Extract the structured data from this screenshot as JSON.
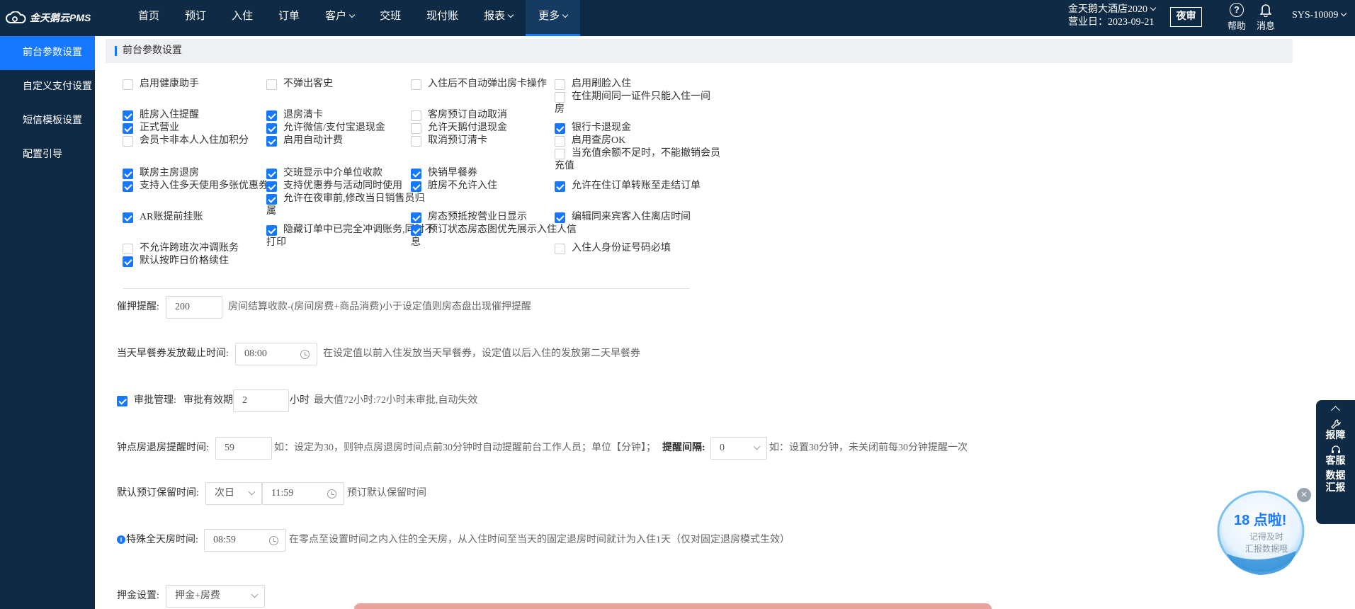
{
  "brand": {
    "name": "金天鹅云PMS"
  },
  "nav": {
    "items": [
      {
        "label": "首页",
        "dropdown": false
      },
      {
        "label": "预订",
        "dropdown": false
      },
      {
        "label": "入住",
        "dropdown": false
      },
      {
        "label": "订单",
        "dropdown": false
      },
      {
        "label": "客户",
        "dropdown": true
      },
      {
        "label": "交班",
        "dropdown": false
      },
      {
        "label": "现付账",
        "dropdown": false
      },
      {
        "label": "报表",
        "dropdown": true
      },
      {
        "label": "更多",
        "dropdown": true,
        "active": true
      }
    ],
    "hotel_name": "金天鹅大酒店2020",
    "business_day": "营业日：2023-09-21",
    "night_audit": "夜审",
    "help": "帮助",
    "messages": "消息",
    "user": "SYS-10009"
  },
  "sidebar": {
    "items": [
      {
        "label": "前台参数设置",
        "active": true
      },
      {
        "label": "自定义支付设置"
      },
      {
        "label": "短信模板设置"
      },
      {
        "label": "配置引导"
      }
    ]
  },
  "section": {
    "title": "前台参数设置"
  },
  "checkboxes": [
    {
      "label": "启用健康助手",
      "checked": false
    },
    {
      "label": "不弹出客史",
      "checked": false
    },
    {
      "label": "入住后不自动弹出房卡操作",
      "checked": false
    },
    {
      "label": "启用刷脸入住",
      "checked": false
    },
    {
      "label": "在住期间同一证件只能入住一间",
      "cont": "房",
      "checked": false
    },
    {
      "label": "脏房入住提醒",
      "checked": true
    },
    {
      "label": "退房清卡",
      "checked": true
    },
    {
      "label": "客房预订自动取消",
      "checked": false
    },
    {
      "label": "正式营业",
      "checked": true
    },
    {
      "label": "允许微信/支付宝退现金",
      "checked": true
    },
    {
      "label": "允许天鹅付退现金",
      "checked": false
    },
    {
      "label": "银行卡退现金",
      "checked": true
    },
    {
      "label": "会员卡非本人入住加积分",
      "checked": false
    },
    {
      "label": "启用自动计费",
      "checked": true
    },
    {
      "label": "取消预订清卡",
      "checked": false
    },
    {
      "label": "启用查房OK",
      "checked": false
    },
    {
      "label": "当充值余额不足时，不能撤销会员",
      "cont": "充值",
      "checked": false
    },
    {
      "label": "联房主房退房",
      "checked": true
    },
    {
      "label": "交班显示中介单位收款",
      "checked": true
    },
    {
      "label": "快销早餐券",
      "checked": true
    },
    {
      "label": "支持入住多天使用多张优惠券",
      "checked": true
    },
    {
      "label": "支持优惠券与活动同时使用",
      "checked": true
    },
    {
      "label": "脏房不允许入住",
      "checked": true
    },
    {
      "label": "允许在住订单转账至走结订单",
      "checked": true
    },
    {
      "label": "允许在夜审前,修改当日销售员归",
      "cont": "属",
      "checked": true
    },
    {
      "label": "AR账提前挂账",
      "checked": true
    },
    {
      "label": "房态预抵按营业日显示",
      "checked": true
    },
    {
      "label": "编辑同来宾客入住离店时间",
      "checked": true
    },
    {
      "label": "隐藏订单中已完全冲调账务,同时不",
      "cont": "打印",
      "checked": true
    },
    {
      "label": "预订状态房态图优先展示入住人信",
      "cont": "息",
      "checked": true
    },
    {
      "label": "不允许跨班次冲调账务",
      "checked": false
    },
    {
      "label": "入住人身份证号码必填",
      "checked": false
    },
    {
      "label": "默认按昨日价格续住",
      "checked": true
    }
  ],
  "settings": {
    "deposit_reminder": {
      "label": "催押提醒:",
      "value": "200",
      "desc": "房间结算收款-(房间房费+商品消费)小于设定值则房态盘出现催押提醒"
    },
    "breakfast_cutoff": {
      "label": "当天早餐券发放截止时间:",
      "value": "08:00",
      "desc": "在设定值以前入住发放当天早餐券，设定值以后入住的发放第二天早餐券"
    },
    "approval": {
      "checked": true,
      "label": "审批管理:",
      "sub_label": "审批有效期",
      "value": "2",
      "unit": "小时",
      "desc": "最大值72小时:72小时未审批,自动失效"
    },
    "hourly_checkout": {
      "label": "钟点房退房提醒时间:",
      "value": "59",
      "desc": "如：设定为30，则钟点房退房时间点前30分钟时自动提醒前台工作人员；单位【分钟】；",
      "interval_label": "提醒间隔:",
      "interval_value": "0",
      "interval_desc": "如：设置30分钟，未关闭前每30分钟提醒一次"
    },
    "reservation_hold": {
      "label": "默认预订保留时间:",
      "day_value": "次日",
      "time_value": "11:59",
      "desc": "预订默认保留时间"
    },
    "special_fullday": {
      "info": "i",
      "label": "特殊全天房时间:",
      "value": "08:59",
      "desc": "在零点至设置时间之内入住的全天房，从入住时间至当天的固定退房时间就计为入住1天（仅对固定退房模式生效）"
    },
    "deposit_setting": {
      "label": "押金设置:",
      "value": "押金+房费"
    }
  },
  "float_panel": {
    "items": [
      {
        "label": "报障",
        "icon": "wrench-icon"
      },
      {
        "label": "客服",
        "icon": "headset-icon"
      },
      {
        "label": "数据\n汇报",
        "icon": ""
      }
    ]
  },
  "promo": {
    "title": "18 点啦!",
    "line1": "记得及时",
    "line2": "汇报数据哦"
  },
  "colors": {
    "nav_bg": "#0f2a44",
    "accent": "#1677ff"
  }
}
